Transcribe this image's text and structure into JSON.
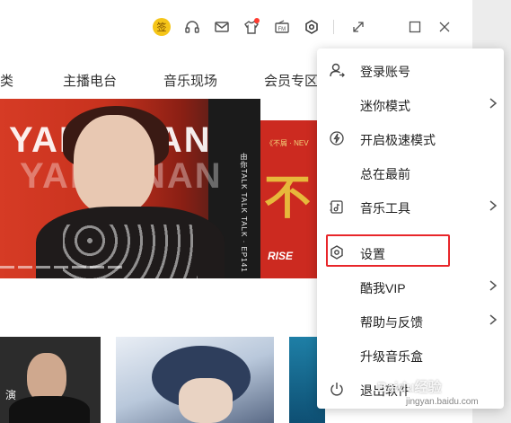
{
  "toolbar": {
    "sign_badge": "签",
    "icons": [
      "headphones-icon",
      "mail-icon",
      "skin-icon",
      "fm-icon",
      "settings-hex-icon",
      "mini-mode-icon",
      "maximize-icon",
      "close-icon"
    ],
    "fm_label": "FM"
  },
  "nav": {
    "items": [
      "分类",
      "主播电台",
      "音乐现场",
      "会员专区"
    ]
  },
  "banner": {
    "title": "YANG NAN",
    "title_echo": "YANG NAN",
    "vertical_text": "由你TALK TALK TALK · EP141",
    "side_top": "《不屑 · NEV",
    "side_big": "不",
    "side_small": "NEV",
    "side_brand": "RISE"
  },
  "thumbs": {
    "first_tag": "演"
  },
  "menu": {
    "items": [
      {
        "label": "登录账号",
        "icon": "user-login-icon",
        "arrow": false
      },
      {
        "label": "迷你模式",
        "icon": "",
        "arrow": true
      },
      {
        "label": "开启极速模式",
        "icon": "lightning-icon",
        "arrow": false
      },
      {
        "label": "总在最前",
        "icon": "",
        "arrow": false
      },
      {
        "label": "音乐工具",
        "icon": "music-tool-icon",
        "arrow": true
      },
      {
        "label": "设置",
        "icon": "settings-hex-icon",
        "arrow": false
      },
      {
        "label": "酷我VIP",
        "icon": "",
        "arrow": true
      },
      {
        "label": "帮助与反馈",
        "icon": "",
        "arrow": true
      },
      {
        "label": "升级音乐盒",
        "icon": "",
        "arrow": false
      },
      {
        "label": "退出软件",
        "icon": "power-icon",
        "arrow": false
      }
    ],
    "highlighted": "设置"
  },
  "watermark": {
    "text": "Baidu经验",
    "sub": "jingyan.baidu.com"
  },
  "colors": {
    "accent_yellow": "#f5c518",
    "highlight_red": "#e8262a",
    "notification_red": "#ff3b30"
  }
}
